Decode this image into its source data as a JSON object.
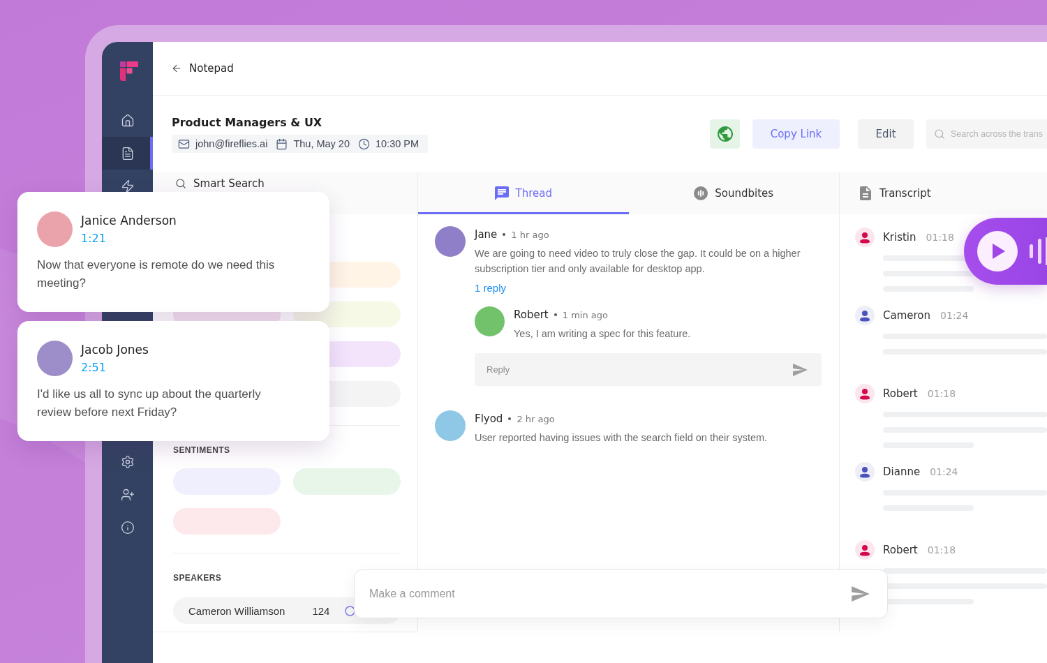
{
  "sidebar": {
    "top_items": [
      {
        "selected": false
      },
      {
        "selected": true
      },
      {
        "selected": false
      }
    ],
    "bottom_items": [
      {
        "selected": false
      },
      {
        "selected": false
      },
      {
        "selected": false
      }
    ]
  },
  "top_bar": {
    "back_label": "Notepad"
  },
  "meeting": {
    "title": "Product Managers & UX",
    "email": "john@fireflies.ai",
    "date": "Thu, May 20",
    "time": "10:30 PM"
  },
  "actions": {
    "copy_link": "Copy Link",
    "edit": "Edit",
    "search": {
      "placeholder": "Search across the trans"
    }
  },
  "left_panel": {
    "search": {
      "placeholder": "Smart Search"
    },
    "topic_rows": [
      {
        "pills": [
          {
            "color": "#fff4e6"
          }
        ]
      },
      {
        "pills": [
          {
            "color": "#f5e4f1"
          },
          {
            "color": "#f6f9e6"
          }
        ]
      },
      {
        "pills": [
          {
            "color": "#f3e4fc"
          }
        ]
      },
      {
        "pills": [
          {
            "color": "#f4f4f4"
          }
        ]
      }
    ],
    "sentiments": {
      "title": "SENTIMENTS",
      "pills": [
        {
          "color": "#f0effe"
        },
        {
          "color": "#e8f5e9"
        },
        {
          "color": "#fde9eb"
        }
      ]
    },
    "speakers": {
      "title": "SPEAKERS",
      "items": [
        {
          "name": "Cameron Williamson",
          "count": "124"
        }
      ]
    }
  },
  "tabs": [
    {
      "label": "Thread",
      "selected": true
    },
    {
      "label": "Soundbites",
      "selected": false
    }
  ],
  "thread": [
    {
      "author": "Jane",
      "time": "1 hr ago",
      "color": "#8f7fc9",
      "text": "We are going to need video to truly close the gap. It could be on a higher subscription tier and only available for desktop app.",
      "replies_label": "1 reply",
      "replies": [
        {
          "author": "Robert",
          "time": "1 min ago",
          "color": "#72c26c",
          "text": "Yes, I am writing a spec for this feature."
        }
      ],
      "reply_field": {
        "placeholder": "Reply"
      }
    },
    {
      "author": "Flyod",
      "time": "2 hr ago",
      "color": "#8ec8e6",
      "text": "User reported having issues with the search field on their system."
    }
  ],
  "transcript": {
    "title": "Transcript",
    "entries": [
      {
        "speaker": "Kristin",
        "time": "01:18",
        "color": "#d5084f",
        "lines": [
          {
            "kind": "full"
          },
          {
            "kind": "full"
          },
          {
            "kind": "short"
          }
        ]
      },
      {
        "speaker": "Cameron",
        "time": "01:24",
        "color": "#4c52bd",
        "lines": [
          {
            "kind": "full"
          },
          {
            "kind": "full"
          }
        ]
      },
      {
        "speaker": "Robert",
        "time": "01:18",
        "color": "#d5084f",
        "lines": [
          {
            "kind": "full"
          },
          {
            "kind": "full"
          },
          {
            "kind": "short"
          }
        ]
      },
      {
        "speaker": "Dianne",
        "time": "01:24",
        "color": "#4c52bd",
        "lines": [
          {
            "kind": "full"
          },
          {
            "kind": "short"
          }
        ]
      },
      {
        "speaker": "Robert",
        "time": "01:18",
        "color": "#d5084f",
        "lines": [
          {
            "kind": "full"
          },
          {
            "kind": "full"
          },
          {
            "kind": "short"
          }
        ]
      }
    ]
  },
  "player": {
    "playing": false
  },
  "highlight_cards": [
    {
      "name": "Janice Anderson",
      "time": "1:21",
      "color": "#eaa3ab",
      "text": "Now that everyone is remote do we need this meeting?"
    },
    {
      "name": "Jacob Jones",
      "time": "2:51",
      "color": "#9d8dc8",
      "text": "I'd like us all to sync up about the quarterly review before next Friday?"
    }
  ],
  "comment_box": {
    "placeholder": "Make a comment"
  }
}
